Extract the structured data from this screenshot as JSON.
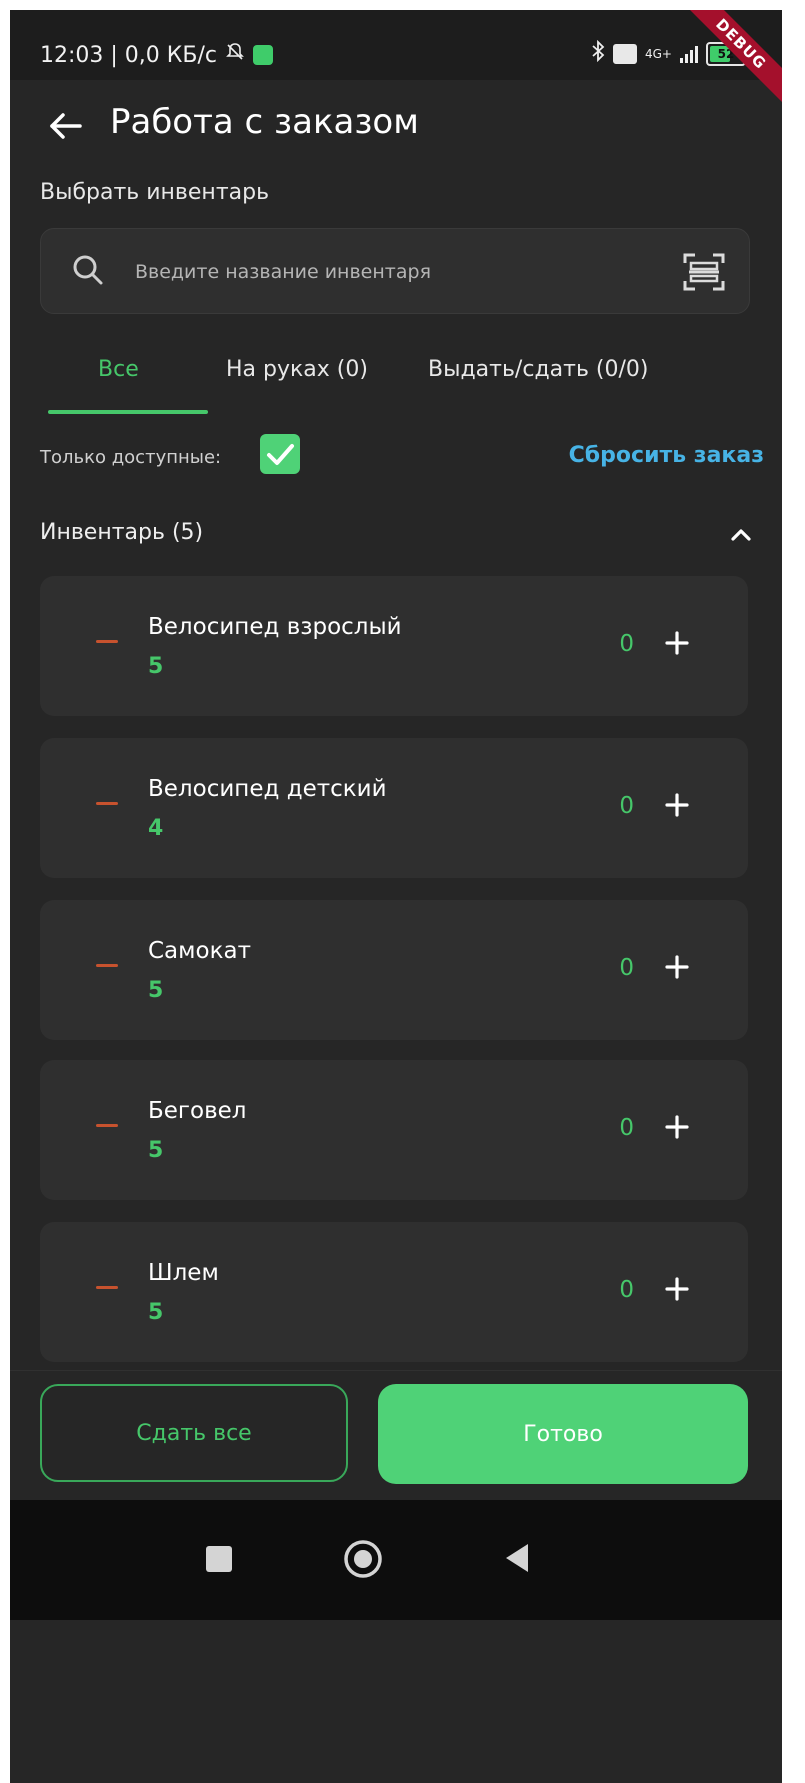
{
  "status_bar": {
    "time_net": "12:03 | 0,0 КБ/с",
    "signal": "4G+",
    "battery": "52"
  },
  "debug_banner": "DEBUG",
  "app_bar": {
    "title": "Работа с заказом"
  },
  "section_label": "Выбрать инвентарь",
  "search": {
    "placeholder": "Введите название инвентаря",
    "value": ""
  },
  "tabs": [
    {
      "label": "Все",
      "selected": true
    },
    {
      "label": "На руках (0)",
      "selected": false
    },
    {
      "label": "Выдать/сдать (0/0)",
      "selected": false
    }
  ],
  "filter": {
    "label": "Только доступные:",
    "checked": true
  },
  "reset_label": "Сбросить заказ",
  "inventory_header": "Инвентарь (5)",
  "items": [
    {
      "name": "Велосипед взрослый",
      "available": "5",
      "qty": "0"
    },
    {
      "name": "Велосипед детский",
      "available": "4",
      "qty": "0"
    },
    {
      "name": "Самокат",
      "available": "5",
      "qty": "0"
    },
    {
      "name": "Беговел",
      "available": "5",
      "qty": "0"
    },
    {
      "name": "Шлем",
      "available": "5",
      "qty": "0"
    }
  ],
  "buttons": {
    "return_all": "Сдать все",
    "done": "Готово"
  },
  "colors": {
    "accent": "#46c76a",
    "link": "#47b3e5",
    "minus": "#c7522e",
    "background": "#262626",
    "card": "#2f2f2f"
  }
}
